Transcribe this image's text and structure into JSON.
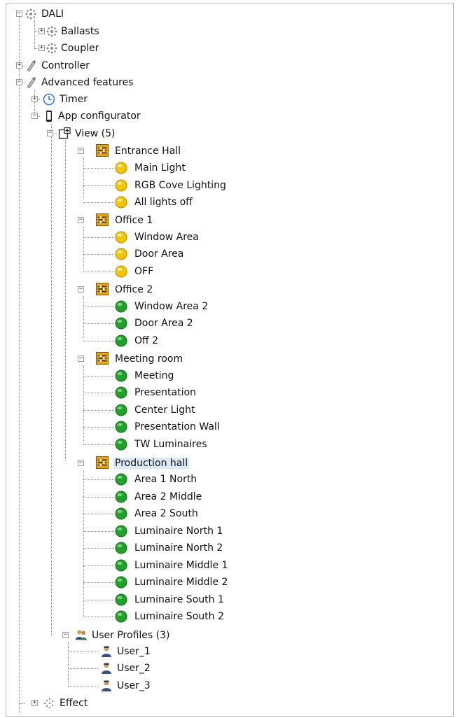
{
  "tree": {
    "dali": "DALI",
    "ballasts": "Ballasts",
    "coupler": "Coupler",
    "controller": "Controller",
    "advanced_features": "Advanced features",
    "timer": "Timer",
    "app_configurator": "App configurator",
    "view": "View (5)",
    "entrance_hall": {
      "label": "Entrance Hall",
      "items": [
        "Main Light",
        "RGB Cove Lighting",
        "All lights off"
      ]
    },
    "office1": {
      "label": "Office 1",
      "items": [
        "Window Area",
        "Door Area",
        "OFF"
      ]
    },
    "office2": {
      "label": "Office 2",
      "items": [
        "Window Area 2",
        "Door Area 2",
        "Off 2"
      ]
    },
    "meeting_room": {
      "label": "Meeting room",
      "items": [
        "Meeting",
        "Presentation",
        "Center Light",
        "Presentation Wall",
        "TW Luminaires"
      ]
    },
    "production_hall": {
      "label": "Production hall",
      "items": [
        "Area 1 North",
        "Area 2 Middle",
        "Area 2 South",
        "Luminaire North 1",
        "Luminaire North 2",
        "Luminaire Middle 1",
        "Luminaire Middle 2",
        "Luminaire South 1",
        "Luminaire South 2"
      ]
    },
    "user_profiles": {
      "label": "User Profiles (3)",
      "items": [
        "User_1",
        "User_2",
        "User_3"
      ]
    },
    "effect": "Effect"
  },
  "colors": {
    "scene_yellow": "#f5c400",
    "scene_green": "#22a12a",
    "room_orange": "#e6a31a",
    "selection": "#dce9f7"
  }
}
